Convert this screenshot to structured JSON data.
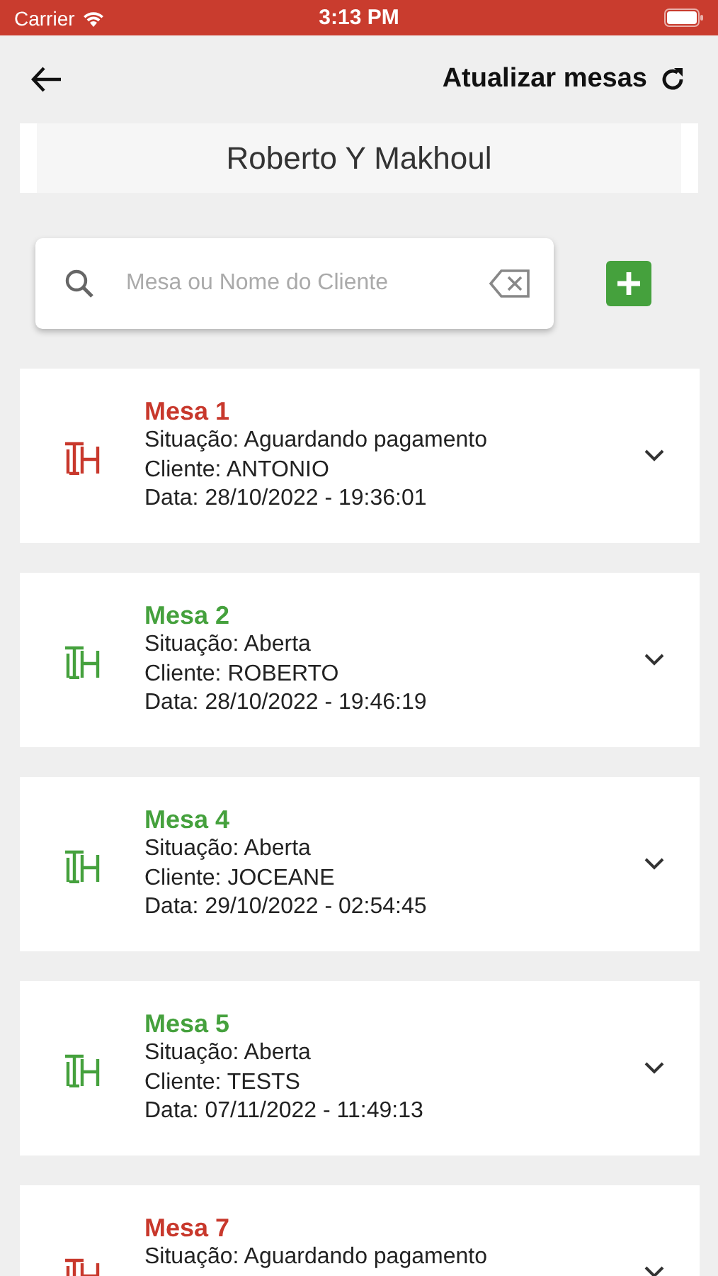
{
  "status_bar": {
    "carrier": "Carrier",
    "time": "3:13 PM"
  },
  "header": {
    "action_label": "Atualizar mesas"
  },
  "user_name": "Roberto Y Makhoul",
  "search": {
    "placeholder": "Mesa ou Nome do Cliente"
  },
  "tables": [
    {
      "title": "Mesa 1",
      "color": "#c8382c",
      "lines": [
        "Situação: Aguardando pagamento",
        "Cliente: ANTONIO",
        "Data: 28/10/2022 - 19:36:01"
      ]
    },
    {
      "title": "Mesa 2",
      "color": "#45a13d",
      "lines": [
        "Situação: Aberta",
        "Cliente: ROBERTO",
        "Data: 28/10/2022 - 19:46:19"
      ]
    },
    {
      "title": "Mesa 4",
      "color": "#45a13d",
      "lines": [
        "Situação: Aberta",
        "Cliente: JOCEANE",
        "Data: 29/10/2022 - 02:54:45"
      ]
    },
    {
      "title": "Mesa 5",
      "color": "#45a13d",
      "lines": [
        "Situação: Aberta",
        "Cliente: TESTS",
        "Data: 07/11/2022 - 11:49:13"
      ]
    },
    {
      "title": "Mesa 7",
      "color": "#c8382c",
      "lines": [
        "Situação: Aguardando pagamento"
      ]
    }
  ]
}
